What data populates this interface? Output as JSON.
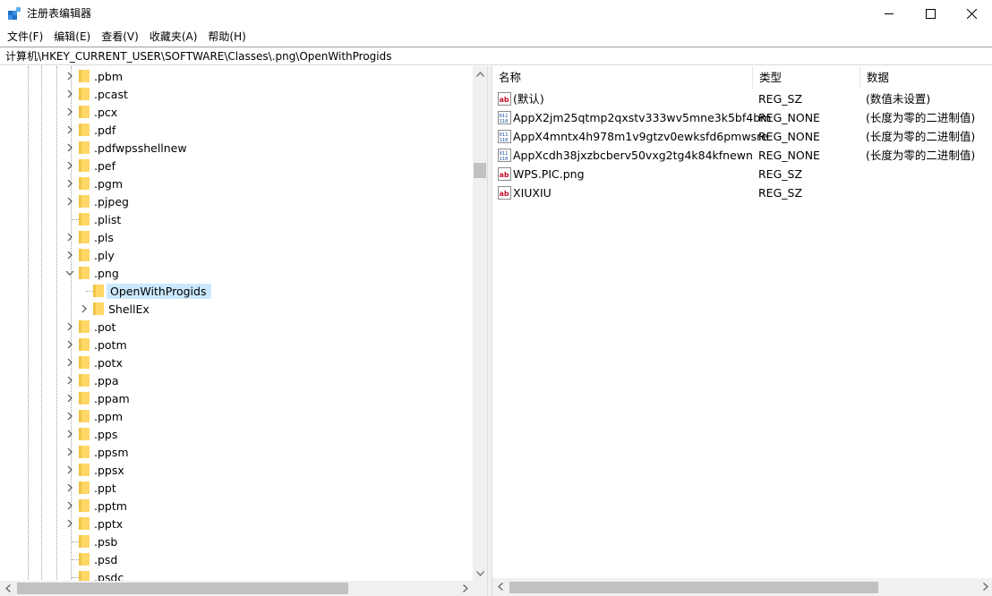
{
  "window": {
    "title": "注册表编辑器",
    "icon": "registry-editor-icon"
  },
  "menu": [
    {
      "label": "文件(F)"
    },
    {
      "label": "编辑(E)"
    },
    {
      "label": "查看(V)"
    },
    {
      "label": "收藏夹(A)"
    },
    {
      "label": "帮助(H)"
    }
  ],
  "address": {
    "path": "计算机\\HKEY_CURRENT_USER\\SOFTWARE\\Classes\\.png\\OpenWithProgids"
  },
  "tree": {
    "items": [
      {
        "label": ".pbm",
        "expander": "collapsed",
        "level": 0
      },
      {
        "label": ".pcast",
        "expander": "collapsed",
        "level": 0
      },
      {
        "label": ".pcx",
        "expander": "collapsed",
        "level": 0
      },
      {
        "label": ".pdf",
        "expander": "collapsed",
        "level": 0
      },
      {
        "label": ".pdfwpsshellnew",
        "expander": "collapsed",
        "level": 0
      },
      {
        "label": ".pef",
        "expander": "collapsed",
        "level": 0
      },
      {
        "label": ".pgm",
        "expander": "collapsed",
        "level": 0
      },
      {
        "label": ".pjpeg",
        "expander": "collapsed",
        "level": 0
      },
      {
        "label": ".plist",
        "expander": "none",
        "level": 0
      },
      {
        "label": ".pls",
        "expander": "collapsed",
        "level": 0
      },
      {
        "label": ".ply",
        "expander": "collapsed",
        "level": 0
      },
      {
        "label": ".png",
        "expander": "expanded",
        "level": 0
      },
      {
        "label": "OpenWithProgids",
        "expander": "none",
        "level": 1,
        "selected": true
      },
      {
        "label": "ShellEx",
        "expander": "collapsed",
        "level": 1
      },
      {
        "label": ".pot",
        "expander": "collapsed",
        "level": 0
      },
      {
        "label": ".potm",
        "expander": "collapsed",
        "level": 0
      },
      {
        "label": ".potx",
        "expander": "collapsed",
        "level": 0
      },
      {
        "label": ".ppa",
        "expander": "collapsed",
        "level": 0
      },
      {
        "label": ".ppam",
        "expander": "collapsed",
        "level": 0
      },
      {
        "label": ".ppm",
        "expander": "collapsed",
        "level": 0
      },
      {
        "label": ".pps",
        "expander": "collapsed",
        "level": 0
      },
      {
        "label": ".ppsm",
        "expander": "collapsed",
        "level": 0
      },
      {
        "label": ".ppsx",
        "expander": "collapsed",
        "level": 0
      },
      {
        "label": ".ppt",
        "expander": "collapsed",
        "level": 0
      },
      {
        "label": ".pptm",
        "expander": "collapsed",
        "level": 0
      },
      {
        "label": ".pptx",
        "expander": "collapsed",
        "level": 0
      },
      {
        "label": ".psb",
        "expander": "none",
        "level": 0
      },
      {
        "label": ".psd",
        "expander": "none",
        "level": 0
      },
      {
        "label": ".psdc",
        "expander": "none",
        "level": 0
      }
    ]
  },
  "values": {
    "columns": {
      "name": "名称",
      "type": "类型",
      "data": "数据"
    },
    "rows": [
      {
        "icon": "string-value-icon",
        "name": "(默认)",
        "type": "REG_SZ",
        "data": "(数值未设置)"
      },
      {
        "icon": "binary-value-icon",
        "name": "AppX2jm25qtmp2qxstv333wv5mne3k5bf4bm",
        "type": "REG_NONE",
        "data": "(长度为零的二进制值)"
      },
      {
        "icon": "binary-value-icon",
        "name": "AppX4mntx4h978m1v9gtzv0ewksfd6pmwsre",
        "type": "REG_NONE",
        "data": "(长度为零的二进制值)"
      },
      {
        "icon": "binary-value-icon",
        "name": "AppXcdh38jxzbcberv50vxg2tg4k84kfnewn",
        "type": "REG_NONE",
        "data": "(长度为零的二进制值)"
      },
      {
        "icon": "string-value-icon",
        "name": "WPS.PIC.png",
        "type": "REG_SZ",
        "data": ""
      },
      {
        "icon": "string-value-icon",
        "name": "XIUXIU",
        "type": "REG_SZ",
        "data": ""
      }
    ]
  },
  "colors": {
    "selection": "#cce8ff",
    "folder": "#ffd766",
    "scrollbar_thumb": "#c1c1c1"
  }
}
